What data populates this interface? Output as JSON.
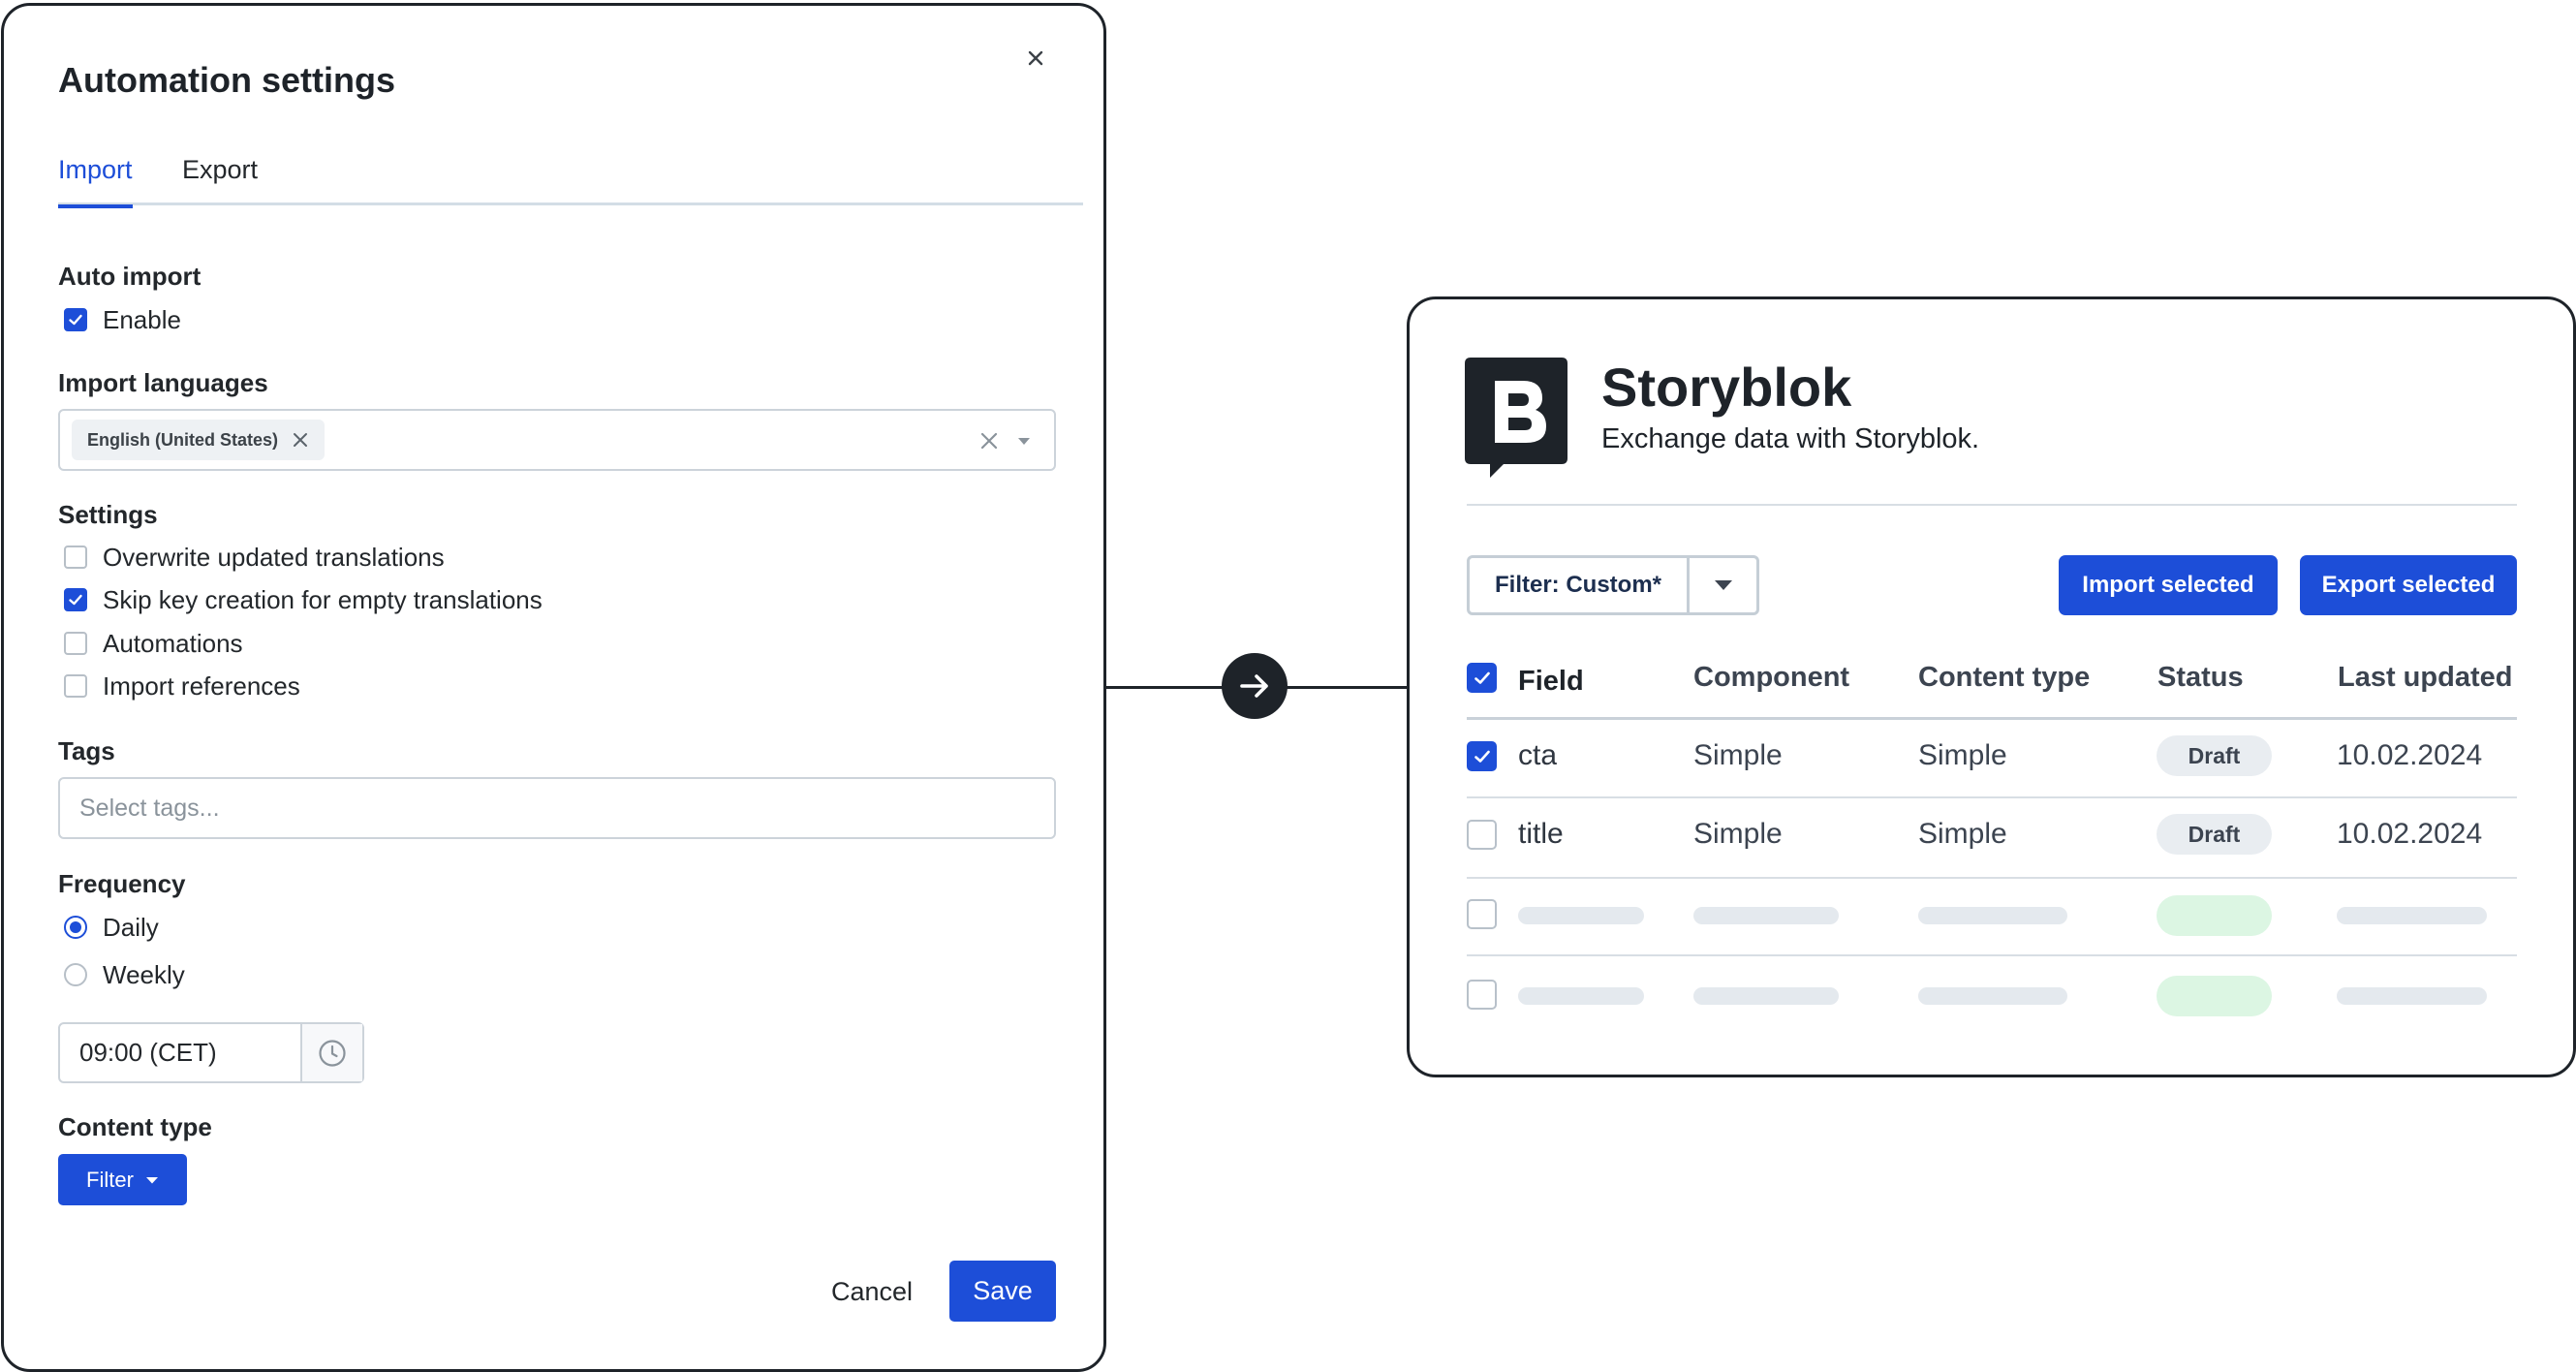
{
  "modal": {
    "title": "Automation settings",
    "tabs": [
      {
        "label": "Import",
        "active": true
      },
      {
        "label": "Export",
        "active": false
      }
    ],
    "auto_import": {
      "label": "Auto import",
      "enable_label": "Enable",
      "checked": true
    },
    "import_languages": {
      "label": "Import languages",
      "selected_chip": "English (United States)"
    },
    "settings": {
      "label": "Settings",
      "options": [
        {
          "label": "Overwrite updated translations",
          "checked": false
        },
        {
          "label": "Skip key creation for empty translations",
          "checked": true
        },
        {
          "label": "Automations",
          "checked": false
        },
        {
          "label": "Import references",
          "checked": false
        }
      ]
    },
    "tags": {
      "label": "Tags",
      "placeholder": "Select tags..."
    },
    "frequency": {
      "label": "Frequency",
      "options": [
        {
          "label": "Daily",
          "selected": true
        },
        {
          "label": "Weekly",
          "selected": false
        }
      ],
      "time_value": "09:00 (CET)"
    },
    "content_type": {
      "label": "Content type",
      "filter_label": "Filter"
    },
    "cancel_label": "Cancel",
    "save_label": "Save"
  },
  "storyblok": {
    "title": "Storyblok",
    "subtitle": "Exchange data with Storyblok.",
    "filter_label": "Filter: Custom*",
    "import_selected_label": "Import selected",
    "export_selected_label": "Export selected",
    "columns": [
      "Field",
      "Component",
      "Content type",
      "Status",
      "Last updated"
    ],
    "rows": [
      {
        "field": "cta",
        "component": "Simple",
        "content_type": "Simple",
        "status": "Draft",
        "last_updated": "10.02.2024",
        "checked": true
      },
      {
        "field": "title",
        "component": "Simple",
        "content_type": "Simple",
        "status": "Draft",
        "last_updated": "10.02.2024",
        "checked": false
      }
    ]
  },
  "colors": {
    "accent": "#1d4ed8",
    "border_dark": "#1e2329",
    "skeleton": "#e4e9ee",
    "skeleton_badge": "#dcf6e3"
  }
}
